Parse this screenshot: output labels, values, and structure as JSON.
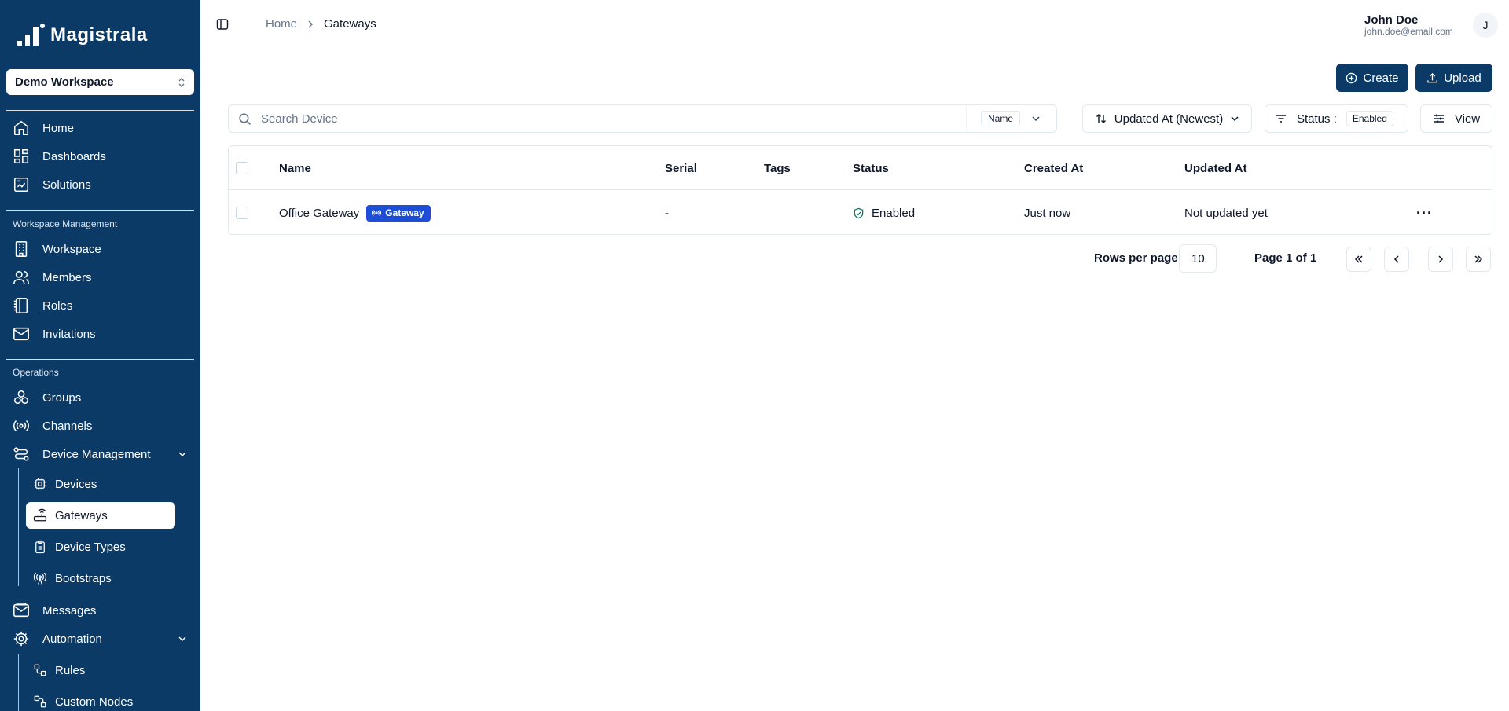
{
  "app": {
    "brand": "Magistrala"
  },
  "workspace_selector": {
    "value": "Demo Workspace"
  },
  "sidebar": {
    "main": [
      {
        "label": "Home",
        "icon": "home-icon"
      },
      {
        "label": "Dashboards",
        "icon": "dashboard-icon"
      },
      {
        "label": "Solutions",
        "icon": "solutions-icon"
      }
    ],
    "workspace_management": {
      "label": "Workspace Management",
      "items": [
        {
          "label": "Workspace",
          "icon": "building-icon"
        },
        {
          "label": "Members",
          "icon": "users-icon"
        },
        {
          "label": "Roles",
          "icon": "notebook-icon"
        },
        {
          "label": "Invitations",
          "icon": "mail-icon"
        }
      ]
    },
    "operations": {
      "label": "Operations",
      "items": [
        {
          "label": "Groups",
          "icon": "groups-icon"
        },
        {
          "label": "Channels",
          "icon": "radio-icon"
        },
        {
          "label": "Device Management",
          "icon": "route-icon"
        }
      ],
      "device_management_children": [
        {
          "label": "Devices",
          "icon": "cpu-icon",
          "active": false
        },
        {
          "label": "Gateways",
          "icon": "router-icon",
          "active": true
        },
        {
          "label": "Device Types",
          "icon": "clipboard-icon",
          "active": false
        },
        {
          "label": "Bootstraps",
          "icon": "antenna-icon",
          "active": false
        }
      ],
      "after": [
        {
          "label": "Messages",
          "icon": "mail-open-icon"
        },
        {
          "label": "Automation",
          "icon": "cog-icon"
        }
      ],
      "automation_children": [
        {
          "label": "Rules",
          "icon": "workflow-icon"
        },
        {
          "label": "Custom Nodes",
          "icon": "nodes-icon"
        }
      ]
    }
  },
  "breadcrumb": {
    "home": "Home",
    "current": "Gateways"
  },
  "user": {
    "name": "John Doe",
    "email": "john.doe@email.com",
    "initial": "J"
  },
  "actions": {
    "create": "Create",
    "upload": "Upload"
  },
  "toolbar": {
    "search_placeholder": "Search Device",
    "search_field": "Name",
    "sort_label": "Updated At (Newest)",
    "status_label": "Status :",
    "status_value": "Enabled",
    "view_label": "View"
  },
  "table": {
    "columns": [
      "Name",
      "Serial",
      "Tags",
      "Status",
      "Created At",
      "Updated At"
    ],
    "rows": [
      {
        "name": "Office Gateway",
        "type_badge": "Gateway",
        "serial": "-",
        "tags": "",
        "status": "Enabled",
        "created_at": "Just now",
        "updated_at": "Not updated yet",
        "actions": "···"
      }
    ]
  },
  "pagination": {
    "rows_per_page_label": "Rows per page",
    "rows_per_page": "10",
    "page_label": "Page 1 of 1"
  },
  "colors": {
    "sidebar_bg": "#0b3a66",
    "primary": "#0b3a66",
    "badge_blue": "#1d4ed8",
    "status_green": "#0f766e"
  }
}
